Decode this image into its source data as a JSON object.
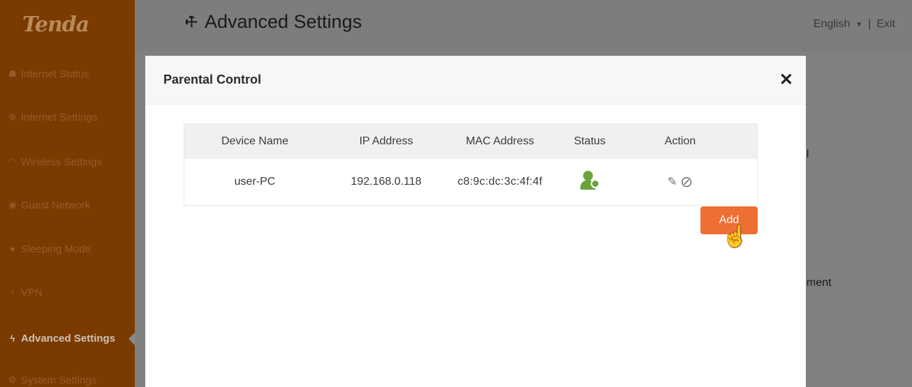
{
  "brand": {
    "logo": "Tenda"
  },
  "header": {
    "title": "Advanced Settings",
    "language": "English",
    "separator": "|",
    "exit_label": "Exit"
  },
  "sidebar": {
    "items": [
      {
        "label": "Internet Status",
        "icon": "router-icon"
      },
      {
        "label": "Internet Settings",
        "icon": "globe-icon"
      },
      {
        "label": "Wireless Settings",
        "icon": "wifi-icon"
      },
      {
        "label": "Guest Network",
        "icon": "guest-icon"
      },
      {
        "label": "Sleeping Mode",
        "icon": "sleep-icon"
      },
      {
        "label": "VPN",
        "icon": "vpn-icon"
      },
      {
        "label": "Advanced Settings",
        "icon": "wrench-icon",
        "active": true
      },
      {
        "label": "System Settings",
        "icon": "gear-icon"
      }
    ]
  },
  "background": {
    "fragment_1": "ol",
    "fragment_2": "ement"
  },
  "modal": {
    "title": "Parental Control",
    "close": "✕",
    "table": {
      "headers": [
        "Device Name",
        "IP Address",
        "MAC Address",
        "Status",
        "Action"
      ],
      "rows": [
        {
          "device_name": "user-PC",
          "ip": "192.168.0.118",
          "mac": "c8:9c:dc:3c:4f:4f",
          "status": "online-user-icon"
        }
      ]
    },
    "add_label": "Add"
  },
  "colors": {
    "sidebar": "#7a3a00",
    "accent": "#ef6e33",
    "status_online": "#6aa33a"
  }
}
